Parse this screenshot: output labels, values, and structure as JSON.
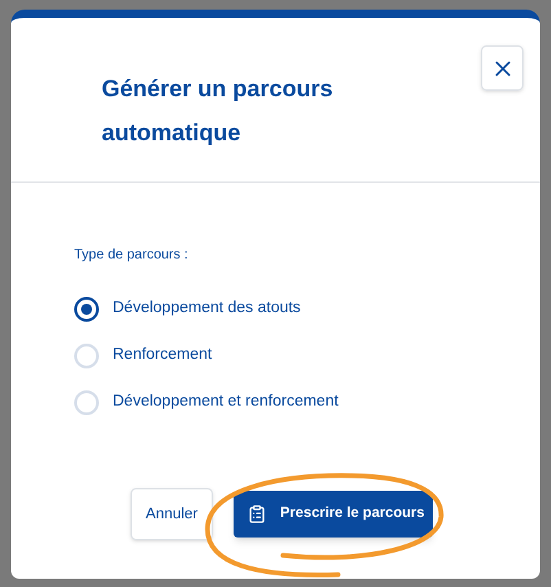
{
  "dialog": {
    "title": "Générer un parcours automatique",
    "field_label": "Type de parcours :",
    "options": [
      {
        "label": "Développement des atouts",
        "selected": true
      },
      {
        "label": "Renforcement",
        "selected": false
      },
      {
        "label": "Développement et renforcement",
        "selected": false
      }
    ],
    "cancel_button": "Annuler",
    "confirm_button": "Prescrire le parcours"
  }
}
